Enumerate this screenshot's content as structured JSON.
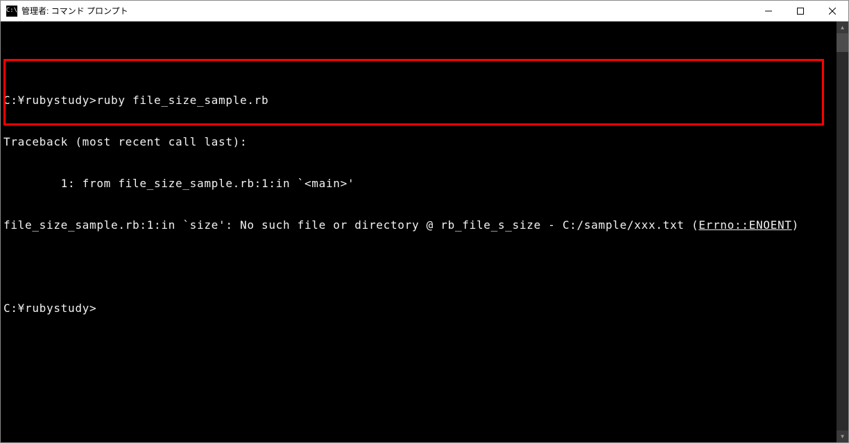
{
  "window": {
    "title": "管理者: コマンド プロンプト"
  },
  "console": {
    "line1": "C:¥rubystudy>ruby file_size_sample.rb",
    "line2": "Traceback (most recent call last):",
    "line3": "        1: from file_size_sample.rb:1:in `<main>'",
    "line4_pre": "file_size_sample.rb:1:in `size': No such file or directory @ rb_file_s_size - C:/sample/xxx.txt (",
    "line4_err": "Errno::ENOENT",
    "line4_post": ")",
    "line6": "C:¥rubystudy>"
  },
  "highlight": {
    "color": "#ff0000"
  }
}
